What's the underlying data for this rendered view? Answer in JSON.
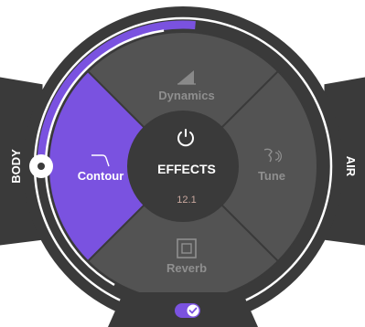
{
  "side_labels": {
    "left": "BODY",
    "right": "AIR"
  },
  "center": {
    "title": "EFFECTS",
    "value": "12.1",
    "power_icon": "power-icon"
  },
  "segments": [
    {
      "id": "dynamics",
      "label": "Dynamics",
      "icon": "dynamics-ramp-icon",
      "active": false
    },
    {
      "id": "tune",
      "label": "Tune",
      "icon": "tune-note-icon",
      "active": false
    },
    {
      "id": "reverb",
      "label": "Reverb",
      "icon": "reverb-square-icon",
      "active": false
    },
    {
      "id": "contour",
      "label": "Contour",
      "icon": "contour-curve-icon",
      "active": true
    }
  ],
  "body_knob": {
    "level": 0.42
  },
  "bottom_toggle": {
    "on": true,
    "icon": "check-icon"
  },
  "colors": {
    "background": "#ffffff",
    "ring_dark": "#3a3a3a",
    "panel": "#4a4a4a",
    "accent": "#7a52e0",
    "segment_inactive": "#535353",
    "text_inactive": "#8f8f8f",
    "value_text": "#c9a89f"
  }
}
